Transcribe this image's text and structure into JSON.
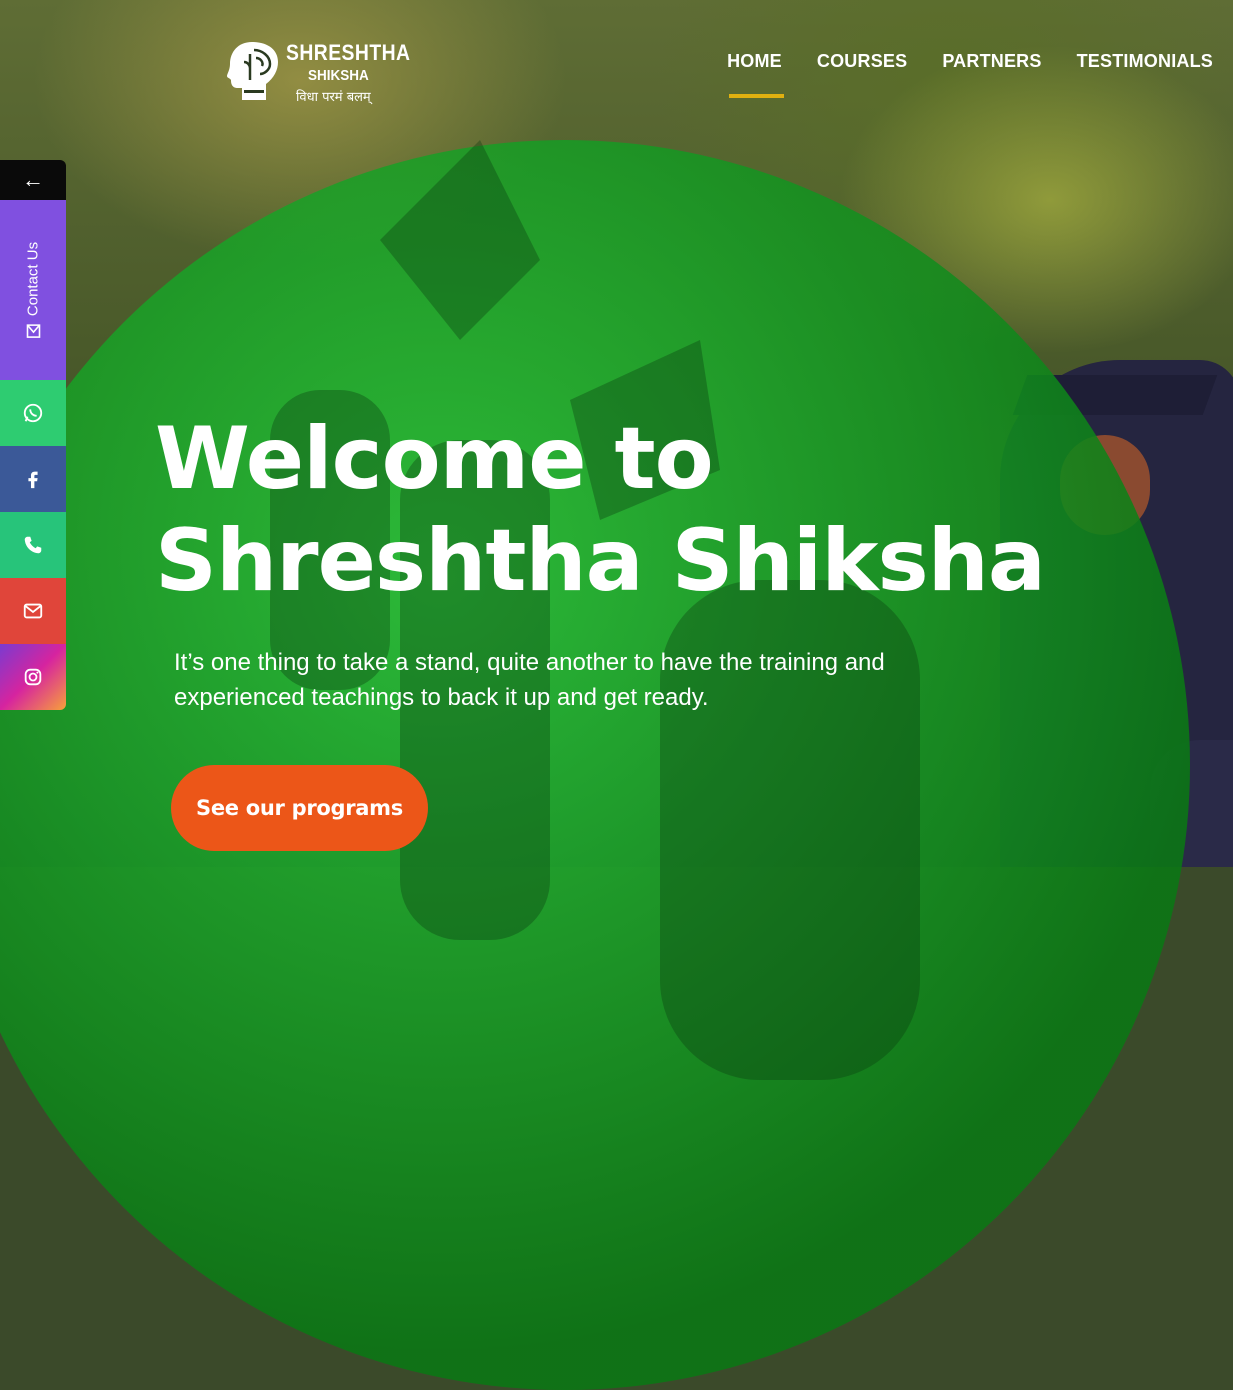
{
  "brand": {
    "name_line1": "SHRESHTHA",
    "name_line2": "SHIKSHA",
    "tagline": "विधा परमं बलम्"
  },
  "nav": {
    "items": [
      {
        "label": "HOME",
        "active": true
      },
      {
        "label": "COURSES",
        "active": false
      },
      {
        "label": "PARTNERS",
        "active": false
      },
      {
        "label": "TESTIMONIALS",
        "active": false
      }
    ]
  },
  "side_panel": {
    "toggle_arrow": "←",
    "contact_label": "Contact Us",
    "buttons": [
      {
        "icon": "whatsapp-icon",
        "color": "#2ecc71"
      },
      {
        "icon": "facebook-icon",
        "color": "#3b5998"
      },
      {
        "icon": "phone-icon",
        "color": "#27c47a"
      },
      {
        "icon": "email-icon",
        "color": "#e0453a"
      },
      {
        "icon": "instagram-icon",
        "color": "#d6249f"
      }
    ]
  },
  "hero": {
    "title_line1": "Welcome to",
    "title_line2": "Shreshtha Shiksha",
    "subtitle": "It’s one thing to take a stand, quite another to have the training and experienced teachings to back it up and get ready.",
    "cta_label": "See our programs"
  },
  "colors": {
    "accent_underline": "#e0b010",
    "cta": "#ec5618",
    "overlay_green": "#1ec832",
    "contact_purple": "#8050e0"
  }
}
